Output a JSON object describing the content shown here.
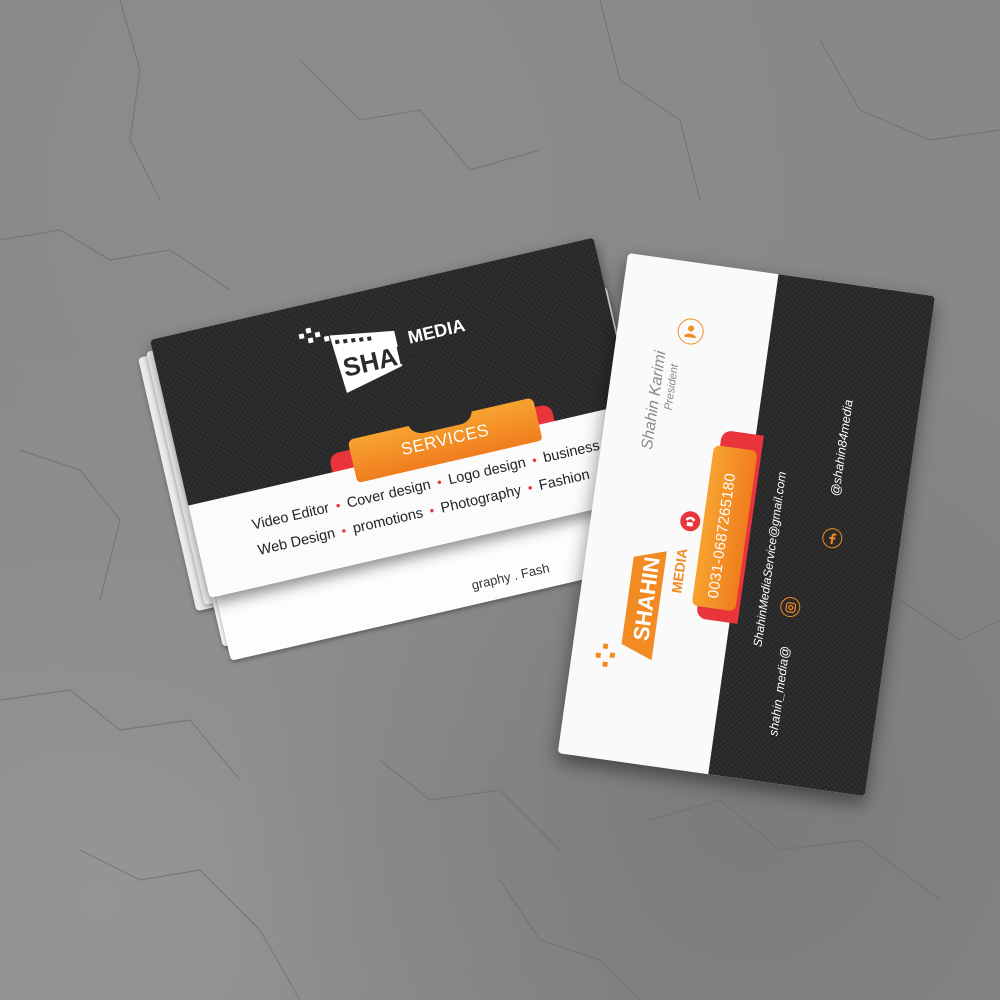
{
  "colors": {
    "accent_orange": "#f28c22",
    "accent_red": "#e8343a",
    "card_dark": "#2b2b2c",
    "card_white": "#fafafa",
    "background_concrete": "#888888"
  },
  "front_card": {
    "logo": {
      "word1": "SHAHIN",
      "word2": "MEDIA"
    },
    "services_label": "SERVICES",
    "services_row1": [
      "Video Editor",
      "Cover design",
      "Logo design",
      "business"
    ],
    "services_row2": [
      "Web Design",
      "promotions",
      "Photography",
      "Fashion"
    ],
    "stack_peek_text": "graphy . Fash"
  },
  "back_card": {
    "person_icon": "person-icon",
    "name": "Shahin Karimi",
    "role": "President",
    "phone_icon": "phone-icon",
    "phone": "0031-0687265180",
    "email": "ShahinMediaService@gmail.com",
    "instagram_icon": "instagram-icon",
    "instagram": "shahin_media@",
    "facebook_icon": "facebook-icon",
    "facebook": "@shahin84media",
    "logo": {
      "word1": "SHAHIN",
      "word2": "MEDIA"
    }
  }
}
